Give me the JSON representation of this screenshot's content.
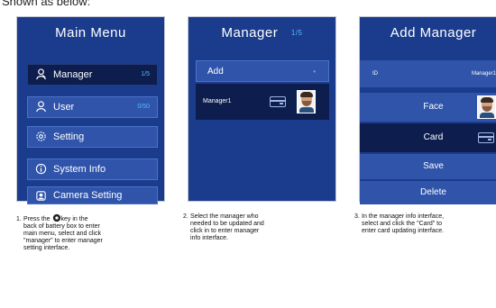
{
  "heading": "Shown as below:",
  "screen1": {
    "title": "Main Menu",
    "items": [
      {
        "label": "Manager",
        "count": "1/5",
        "icon": "manager-icon"
      },
      {
        "label": "User",
        "count": "0/50",
        "icon": "user-icon"
      },
      {
        "label": "Setting",
        "count": "",
        "icon": "gear-icon"
      },
      {
        "label": "System Info",
        "count": "",
        "icon": "info-icon"
      },
      {
        "label": "Camera Setting",
        "count": "",
        "icon": "camera-icon"
      }
    ]
  },
  "screen2": {
    "title": "Manager",
    "pager": "1/5",
    "add_label": "Add",
    "add_marker": "•",
    "manager_name": "Manager1"
  },
  "screen3": {
    "title": "Add Manager",
    "id_label": "ID",
    "id_value": "Manager1",
    "face_label": "Face",
    "card_label": "Card",
    "save_label": "Save",
    "delete_label": "Delete"
  },
  "instructions": [
    {
      "num": "1.",
      "lines": [
        "Press the",
        "key in the",
        "back of battery box to enter",
        "main menu, select and click",
        "\"manager\" to enter manager",
        "setting interface."
      ]
    },
    {
      "num": "2.",
      "lines": [
        "Select the manager who",
        "needed to be updated and",
        "click in to enter manager",
        "info interface."
      ]
    },
    {
      "num": "3.",
      "lines": [
        "In the manager info interface,",
        "select and click the \"Card\" to",
        "enter card updating interface."
      ]
    }
  ],
  "colors": {
    "screen_bg": "#1b3c8c",
    "item_bg": "#2f54aa",
    "selected_bg": "#0c1d4e",
    "accent": "#55b8ff"
  }
}
